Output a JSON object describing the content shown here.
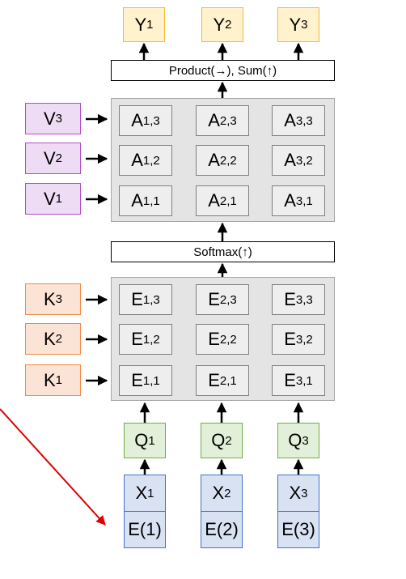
{
  "outputs": [
    {
      "base": "Y",
      "sub": "1"
    },
    {
      "base": "Y",
      "sub": "2"
    },
    {
      "base": "Y",
      "sub": "3"
    }
  ],
  "product_sum_label": "Product(→),   Sum(↑)",
  "values": [
    {
      "base": "V",
      "sub": "3"
    },
    {
      "base": "V",
      "sub": "2"
    },
    {
      "base": "V",
      "sub": "1"
    }
  ],
  "attention_grid": [
    [
      {
        "base": "A",
        "sub": "1,3"
      },
      {
        "base": "A",
        "sub": "2,3"
      },
      {
        "base": "A",
        "sub": "3,3"
      }
    ],
    [
      {
        "base": "A",
        "sub": "1,2"
      },
      {
        "base": "A",
        "sub": "2,2"
      },
      {
        "base": "A",
        "sub": "3,2"
      }
    ],
    [
      {
        "base": "A",
        "sub": "1,1"
      },
      {
        "base": "A",
        "sub": "2,1"
      },
      {
        "base": "A",
        "sub": "3,1"
      }
    ]
  ],
  "softmax_label": "Softmax(↑)",
  "keys": [
    {
      "base": "K",
      "sub": "3"
    },
    {
      "base": "K",
      "sub": "2"
    },
    {
      "base": "K",
      "sub": "1"
    }
  ],
  "energy_grid": [
    [
      {
        "base": "E",
        "sub": "1,3"
      },
      {
        "base": "E",
        "sub": "2,3"
      },
      {
        "base": "E",
        "sub": "3,3"
      }
    ],
    [
      {
        "base": "E",
        "sub": "1,2"
      },
      {
        "base": "E",
        "sub": "2,2"
      },
      {
        "base": "E",
        "sub": "3,2"
      }
    ],
    [
      {
        "base": "E",
        "sub": "1,1"
      },
      {
        "base": "E",
        "sub": "2,1"
      },
      {
        "base": "E",
        "sub": "3,1"
      }
    ]
  ],
  "queries": [
    {
      "base": "Q",
      "sub": "1"
    },
    {
      "base": "Q",
      "sub": "2"
    },
    {
      "base": "Q",
      "sub": "3"
    }
  ],
  "inputs": [
    {
      "base": "X",
      "sub": "1"
    },
    {
      "base": "X",
      "sub": "2"
    },
    {
      "base": "X",
      "sub": "3"
    }
  ],
  "position_embeddings": [
    "E(1)",
    "E(2)",
    "E(3)"
  ],
  "colors": {
    "output_fill": "#fff2cc",
    "value_fill": "#eedcf5",
    "key_fill": "#fbe3d5",
    "query_fill": "#e2f0d9",
    "input_fill": "#d9e2f3",
    "panel_fill": "#e4e4e4",
    "pointer_arrow": "#e00000"
  }
}
